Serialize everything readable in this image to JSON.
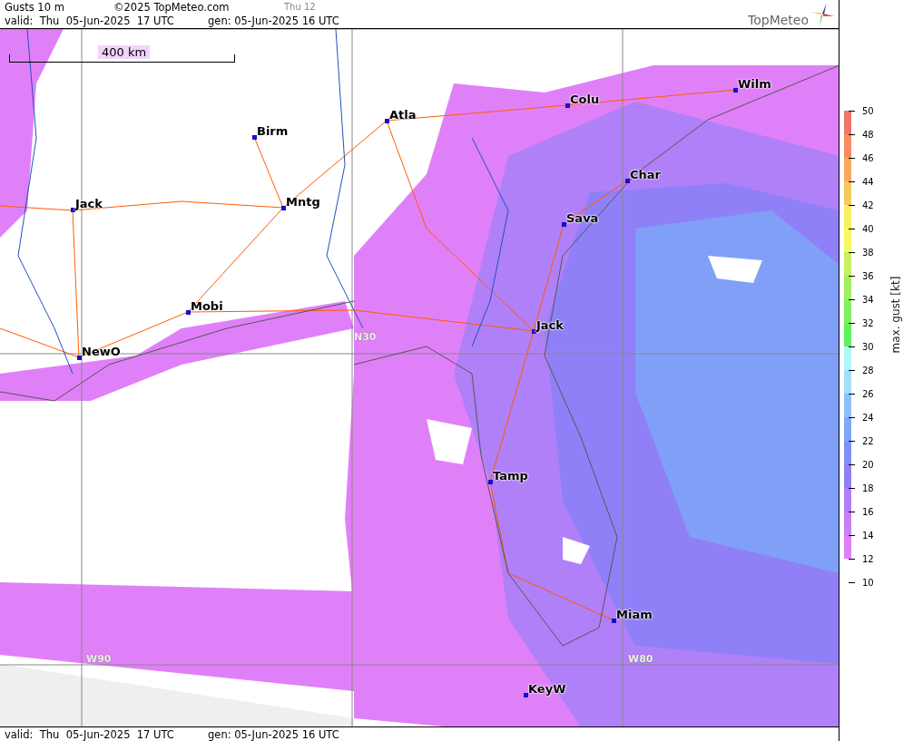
{
  "header": {
    "title": "Gusts 10 m",
    "copyright": "©2025 TopMeteo.com",
    "step": "Thu 12",
    "valid": "valid:  Thu  05-Jun-2025  17 UTC",
    "gen": "gen: 05-Jun-2025 16 UTC",
    "logo": "TopMeteo"
  },
  "map": {
    "scale": "400 km",
    "grid_labels": [
      "N30",
      "W90",
      "W80"
    ],
    "cities": [
      "Birm",
      "Atla",
      "Colu",
      "Wilm",
      "Char",
      "Jack",
      "Mntg",
      "Sava",
      "Mobi",
      "Jack",
      "NewO",
      "Tamp",
      "Miam",
      "KeyW"
    ]
  },
  "legend": {
    "title": "max. gust [kt]",
    "ticks": [
      "50",
      "48",
      "46",
      "44",
      "42",
      "40",
      "38",
      "36",
      "34",
      "32",
      "30",
      "28",
      "26",
      "24",
      "22",
      "20",
      "18",
      "16",
      "14",
      "12",
      "10"
    ],
    "bands": [
      {
        "color": "#f07468"
      },
      {
        "color": "#f88c60"
      },
      {
        "color": "#f8a860"
      },
      {
        "color": "#f8c860"
      },
      {
        "color": "#f8f060"
      },
      {
        "color": "#f8f860"
      },
      {
        "color": "#c8f060"
      },
      {
        "color": "#a0f060"
      },
      {
        "color": "#80f060"
      },
      {
        "color": "#60f060"
      },
      {
        "color": "#b0f8f8"
      },
      {
        "color": "#a0e0f8"
      },
      {
        "color": "#90c0f8"
      },
      {
        "color": "#80a8f8"
      },
      {
        "color": "#8090f8"
      },
      {
        "color": "#9080f8"
      },
      {
        "color": "#b080f8"
      },
      {
        "color": "#c880f8"
      },
      {
        "color": "#e080f8"
      }
    ]
  },
  "footer": {
    "valid": "valid:  Thu  05-Jun-2025  17 UTC",
    "gen": "gen: 05-Jun-2025 16 UTC"
  }
}
